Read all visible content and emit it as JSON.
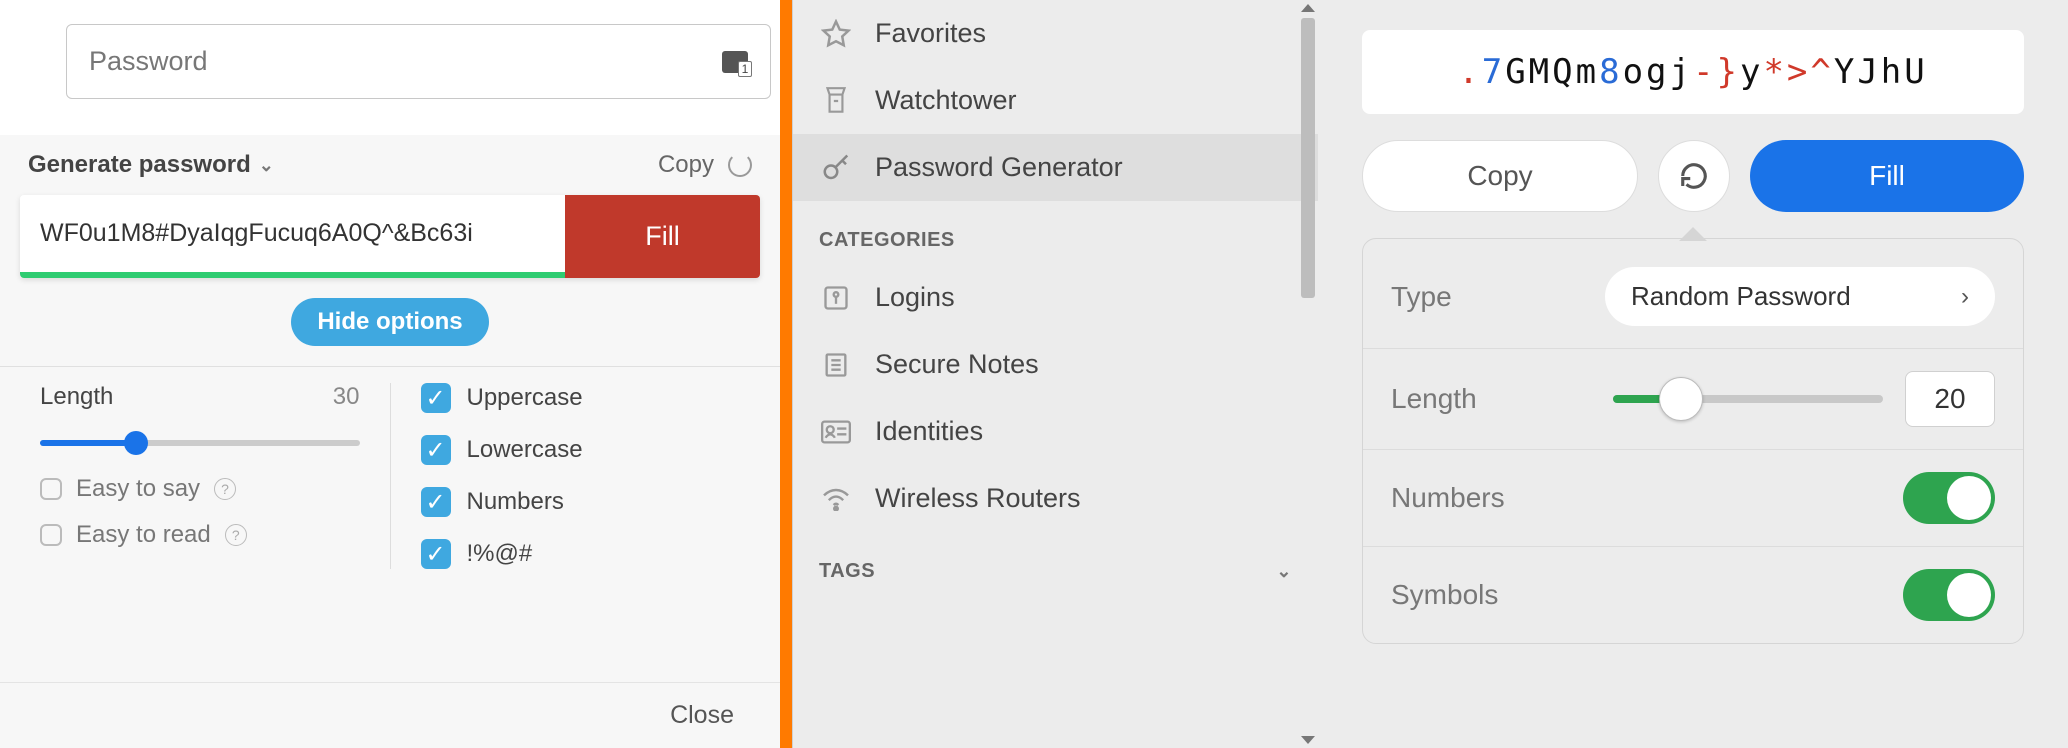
{
  "left": {
    "password_placeholder": "Password",
    "title": "Generate password",
    "copy_label": "Copy",
    "generated": "WF0u1M8#DyaIqgFucuq6A0Q^&Bc63i",
    "fill_label": "Fill",
    "hide_label": "Hide options",
    "length_label": "Length",
    "length_value": "30",
    "easy_say": "Easy to say",
    "easy_read": "Easy to read",
    "opt_upper": "Uppercase",
    "opt_lower": "Lowercase",
    "opt_numbers": "Numbers",
    "opt_symbols": "!%@#",
    "close_label": "Close"
  },
  "middle": {
    "nav": {
      "favorites": "Favorites",
      "watchtower": "Watchtower",
      "generator": "Password Generator"
    },
    "categories_head": "CATEGORIES",
    "cats": {
      "logins": "Logins",
      "notes": "Secure Notes",
      "identities": "Identities",
      "routers": "Wireless Routers"
    },
    "tags_head": "TAGS"
  },
  "right": {
    "segments": [
      {
        "t": "s",
        "v": "."
      },
      {
        "t": "d",
        "v": "7"
      },
      {
        "t": "l",
        "v": "GMQm"
      },
      {
        "t": "d",
        "v": "8"
      },
      {
        "t": "l",
        "v": "ogj"
      },
      {
        "t": "s",
        "v": "-}"
      },
      {
        "t": "l",
        "v": "y"
      },
      {
        "t": "s",
        "v": "*>^"
      },
      {
        "t": "l",
        "v": "YJhU"
      }
    ],
    "copy": "Copy",
    "fill": "Fill",
    "type_label": "Type",
    "type_value": "Random Password",
    "length_label": "Length",
    "length_value": "20",
    "numbers_label": "Numbers",
    "symbols_label": "Symbols"
  }
}
